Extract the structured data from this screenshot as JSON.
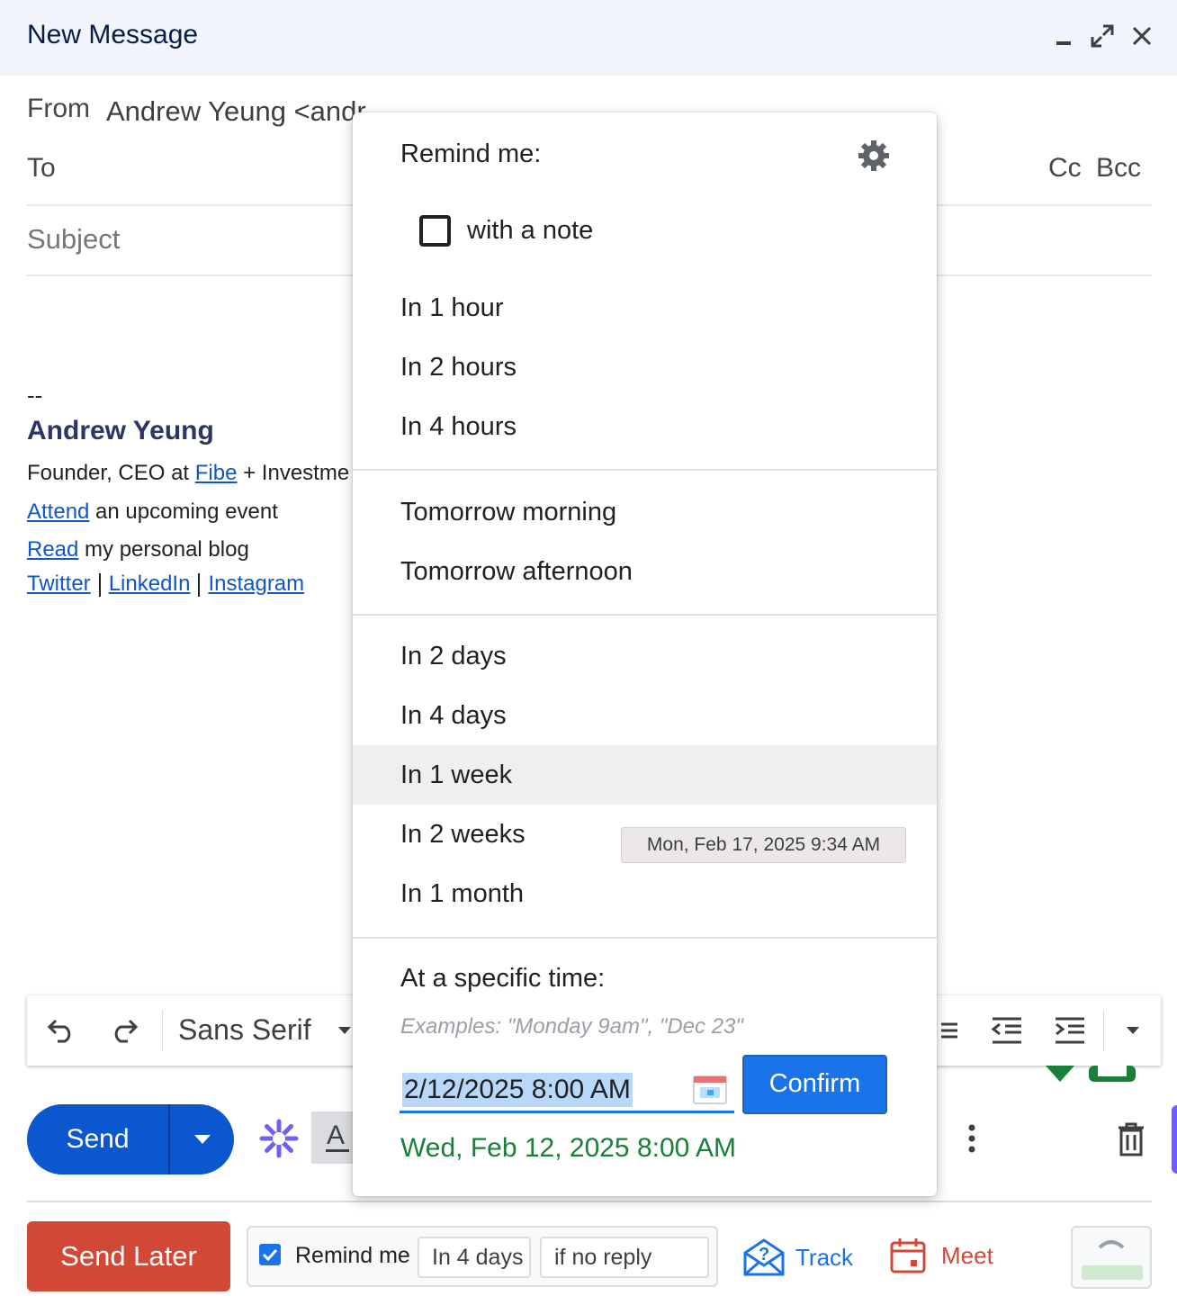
{
  "window": {
    "title": "New Message",
    "minimize_icon": "minimize-icon",
    "popout_icon": "popout-icon",
    "close_icon": "close-icon"
  },
  "compose": {
    "from_label": "From",
    "from_value": "Andrew Yeung <andrew@meetfibe.com>",
    "to_label": "To",
    "cc_label": "Cc",
    "bcc_label": "Bcc",
    "subject_placeholder": "Subject"
  },
  "signature": {
    "dashes": "--",
    "name": "Andrew Yeung",
    "line1_prefix": "Founder, CEO at ",
    "line1_link": "Fibe",
    "line1_suffix": " + Investme",
    "line2_link": "Attend",
    "line2_text": " an upcoming event",
    "line3_link": "Read",
    "line3_text": " my personal blog",
    "social": [
      "Twitter",
      "LinkedIn",
      "Instagram"
    ]
  },
  "toolbar": {
    "font": "Sans Serif"
  },
  "send": {
    "label": "Send"
  },
  "bottom_bar": {
    "send_later": "Send Later",
    "remind_checked": true,
    "remind_label": "Remind me",
    "remind_when": "In 4 days",
    "remind_condition": "if no reply",
    "track_label": "Track",
    "meet_label": "Meet"
  },
  "menu": {
    "title": "Remind me:",
    "note_label": "with a note",
    "note_checked": false,
    "group1": [
      "In 1 hour",
      "In 2 hours",
      "In 4 hours"
    ],
    "group2": [
      "Tomorrow morning",
      "Tomorrow afternoon"
    ],
    "group3": [
      "In 2 days",
      "In 4 days",
      "In 1 week",
      "In 2 weeks",
      "In 1 month"
    ],
    "active_item": "In 1 week",
    "tooltip": "Mon, Feb 17, 2025 9:34 AM",
    "specific_heading": "At a specific time:",
    "examples": "Examples: \"Monday 9am\", \"Dec 23\"",
    "datetime_value": "2/12/2025 8:00 AM",
    "confirm": "Confirm",
    "parsed": "Wed, Feb 12, 2025 8:00 AM"
  },
  "colors": {
    "send_blue": "#0b57d0",
    "send_later_red": "#d14836",
    "parsed_green": "#188038"
  }
}
